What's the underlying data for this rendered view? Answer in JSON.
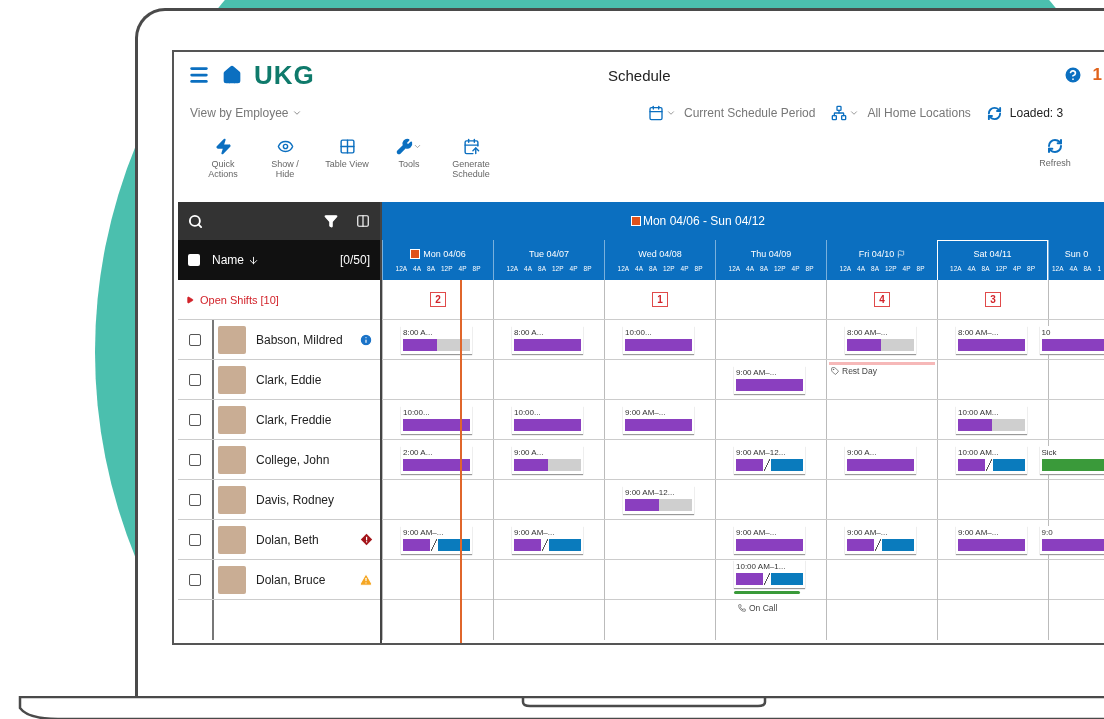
{
  "header": {
    "logo": "UKG",
    "title": "Schedule",
    "alert_count": "1"
  },
  "subbar": {
    "view": "View by Employee",
    "period": "Current Schedule Period",
    "locations": "All Home Locations",
    "loaded": "Loaded: 3"
  },
  "toolbar": [
    {
      "kind": "quick",
      "label": "Quick Actions"
    },
    {
      "kind": "show",
      "label": "Show / Hide"
    },
    {
      "kind": "table",
      "label": "Table View"
    },
    {
      "kind": "tools",
      "label": "Tools"
    },
    {
      "kind": "generate",
      "label": "Generate Schedule"
    }
  ],
  "refresh": {
    "label": "Refresh"
  },
  "roster": {
    "name_header": "Name",
    "count": "[0/50]",
    "all_checked": false
  },
  "period": {
    "label": "Mon 04/06 - Sun 04/12"
  },
  "days": [
    {
      "label": "Mon 04/06",
      "today": true,
      "flagged": false,
      "selected": false,
      "open_count": "2",
      "hours": [
        "12A",
        "4A",
        "8A",
        "12P",
        "4P",
        "8P"
      ]
    },
    {
      "label": "Tue 04/07",
      "today": false,
      "flagged": false,
      "selected": false,
      "hours": [
        "12A",
        "4A",
        "8A",
        "12P",
        "4P",
        "8P"
      ]
    },
    {
      "label": "Wed 04/08",
      "today": false,
      "flagged": false,
      "selected": false,
      "open_count": "1",
      "hours": [
        "12A",
        "4A",
        "8A",
        "12P",
        "4P",
        "8P"
      ]
    },
    {
      "label": "Thu 04/09",
      "today": false,
      "flagged": false,
      "selected": false,
      "hours": [
        "12A",
        "4A",
        "8A",
        "12P",
        "4P",
        "8P"
      ]
    },
    {
      "label": "Fri 04/10",
      "today": false,
      "flagged": true,
      "selected": false,
      "open_count": "4",
      "hours": [
        "12A",
        "4A",
        "8A",
        "12P",
        "4P",
        "8P"
      ]
    },
    {
      "label": "Sat 04/11",
      "today": false,
      "flagged": false,
      "selected": true,
      "open_count": "3",
      "hours": [
        "12A",
        "4A",
        "8A",
        "12P",
        "4P",
        "8P"
      ]
    },
    {
      "label": "Sun 0",
      "today": false,
      "flagged": false,
      "selected": false,
      "hours": [
        "12A",
        "4A",
        "8A",
        "1"
      ]
    }
  ],
  "open_shifts": {
    "label": "Open Shifts [10]",
    "expanded": false
  },
  "employees": [
    {
      "name": "Babson, Mildred",
      "checked": false,
      "indicator": {
        "kind": "info"
      },
      "cells": [
        {
          "kind": "shift",
          "label": "8:00 A...",
          "bar": {
            "kind": "partial"
          }
        },
        {
          "kind": "shift",
          "label": "8:00 A...",
          "bar": {
            "kind": "plain"
          }
        },
        {
          "kind": "shift",
          "label": "10:00...",
          "bar": {
            "kind": "plain"
          }
        },
        {
          "kind": "empty"
        },
        {
          "kind": "shift",
          "label": "8:00 AM–...",
          "bar": {
            "kind": "partial"
          }
        },
        {
          "kind": "shift",
          "label": "8:00 AM–...",
          "bar": {
            "kind": "plain"
          }
        },
        {
          "kind": "shift",
          "label": "10",
          "bar": {
            "kind": "plain"
          }
        }
      ]
    },
    {
      "name": "Clark, Eddie",
      "checked": false,
      "cells": [
        {
          "kind": "empty"
        },
        {
          "kind": "empty"
        },
        {
          "kind": "empty"
        },
        {
          "kind": "shift",
          "label": "9:00 AM–...",
          "bar": {
            "kind": "plain"
          }
        },
        {
          "kind": "rest",
          "label": "Rest Day"
        },
        {
          "kind": "empty"
        },
        {
          "kind": "empty"
        }
      ]
    },
    {
      "name": "Clark, Freddie",
      "checked": false,
      "cells": [
        {
          "kind": "shift",
          "label": "10:00...",
          "bar": {
            "kind": "plain"
          }
        },
        {
          "kind": "shift",
          "label": "10:00...",
          "bar": {
            "kind": "plain"
          }
        },
        {
          "kind": "shift",
          "label": "9:00 AM–...",
          "bar": {
            "kind": "plain"
          }
        },
        {
          "kind": "empty"
        },
        {
          "kind": "empty"
        },
        {
          "kind": "shift",
          "label": "10:00 AM...",
          "bar": {
            "kind": "partial"
          }
        },
        {
          "kind": "empty"
        }
      ]
    },
    {
      "name": "College, John",
      "checked": false,
      "cells": [
        {
          "kind": "shift",
          "label": "2:00 A...",
          "bar": {
            "kind": "plain"
          }
        },
        {
          "kind": "shift",
          "label": "9:00 A...",
          "bar": {
            "kind": "partial"
          }
        },
        {
          "kind": "empty"
        },
        {
          "kind": "shift",
          "label": "9:00 AM–12...",
          "bar": {
            "kind": "split"
          }
        },
        {
          "kind": "shift",
          "label": "9:00 A...",
          "bar": {
            "kind": "plain"
          }
        },
        {
          "kind": "shift",
          "label": "10:00 AM...",
          "bar": {
            "kind": "split"
          }
        },
        {
          "kind": "shift",
          "label": "Sick",
          "bar": {
            "kind": "sick"
          }
        }
      ]
    },
    {
      "name": "Davis, Rodney",
      "checked": false,
      "cells": [
        {
          "kind": "empty"
        },
        {
          "kind": "empty"
        },
        {
          "kind": "shift",
          "label": "9:00 AM–12...",
          "bar": {
            "kind": "partial"
          }
        },
        {
          "kind": "empty"
        },
        {
          "kind": "empty"
        },
        {
          "kind": "empty"
        },
        {
          "kind": "empty"
        }
      ]
    },
    {
      "name": "Dolan, Beth",
      "checked": false,
      "indicator": {
        "kind": "alert"
      },
      "cells": [
        {
          "kind": "shift",
          "label": "9:00 AM–...",
          "bar": {
            "kind": "split"
          }
        },
        {
          "kind": "shift",
          "label": "9:00 AM–...",
          "bar": {
            "kind": "split"
          }
        },
        {
          "kind": "empty"
        },
        {
          "kind": "shift",
          "label": "9:00 AM–...",
          "bar": {
            "kind": "plain"
          }
        },
        {
          "kind": "shift",
          "label": "9:00 AM–...",
          "bar": {
            "kind": "split"
          }
        },
        {
          "kind": "shift",
          "label": "9:00 AM–...",
          "bar": {
            "kind": "plain"
          }
        },
        {
          "kind": "shift",
          "label": "9:0",
          "bar": {
            "kind": "plain"
          }
        }
      ]
    },
    {
      "name": "Dolan, Bruce",
      "checked": false,
      "indicator": {
        "kind": "warning"
      },
      "cells": [
        {
          "kind": "empty"
        },
        {
          "kind": "empty"
        },
        {
          "kind": "empty"
        },
        {
          "kind": "shift",
          "label": "10:00 AM–1...",
          "bar": {
            "kind": "split"
          },
          "on_call": "On Call"
        },
        {
          "kind": "empty"
        },
        {
          "kind": "empty"
        },
        {
          "kind": "empty"
        }
      ]
    }
  ]
}
